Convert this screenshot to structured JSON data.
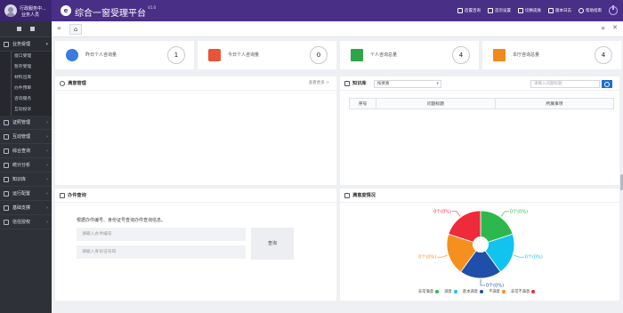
{
  "header": {
    "user_name": "行政服务中...",
    "user_role": "业务人员",
    "logo_glyph": "e",
    "title": "综合一窗受理平台",
    "version": "V1.0",
    "links": [
      "后置咨询",
      "首页设置",
      "切换皮肤",
      "版本日志",
      "帮助指南"
    ]
  },
  "sidebar": {
    "menu": [
      {
        "label": "业务受理",
        "open": true,
        "items": [
          "窗口受理",
          "暂存受理",
          "材料出库",
          "办件预审",
          "咨询服务",
          "互动投诉"
        ]
      },
      {
        "label": "证照管理",
        "open": false
      },
      {
        "label": "互动管理",
        "open": false
      },
      {
        "label": "综合查询",
        "open": false
      },
      {
        "label": "统计分析",
        "open": false
      },
      {
        "label": "知识库",
        "open": false
      },
      {
        "label": "运行配置",
        "open": false
      },
      {
        "label": "基础支撑",
        "open": false
      },
      {
        "label": "信任授权",
        "open": false
      }
    ]
  },
  "tabs": {
    "home_glyph": "⌂"
  },
  "stats": [
    {
      "label": "昨日个人咨询量",
      "value": "1",
      "color": "#3a7be0"
    },
    {
      "label": "今日个人咨询量",
      "value": "0",
      "color": "#e8543a"
    },
    {
      "label": "个人咨询总量",
      "value": "4",
      "color": "#2fa54a"
    },
    {
      "label": "本厅咨询总量",
      "value": "4",
      "color": "#f08a1c"
    }
  ],
  "satisfaction_panel": {
    "title": "满意管理",
    "more": "查看更多 >"
  },
  "knowledge_panel": {
    "title": "知识库",
    "select_value": "按要素",
    "search_placeholder": "请输入问题标题",
    "columns": [
      "序号",
      "问题标题",
      "所属事项"
    ]
  },
  "query_panel": {
    "title": "办件查询",
    "instruction": "根据办件编号、身份证号查询办件查询信息。",
    "case_placeholder": "请输入办件编号",
    "id_placeholder": "请输入身份证号码",
    "button_label": "查询"
  },
  "chart_panel": {
    "title": "满意度情况"
  },
  "chart_data": {
    "type": "pie",
    "title": "满意度情况",
    "series": [
      {
        "name": "非常满意",
        "value": 0,
        "label": "0个(0%)",
        "color": "#2db84d"
      },
      {
        "name": "满意",
        "value": 0,
        "label": "0个(0%)",
        "color": "#12c3f0"
      },
      {
        "name": "基本满意",
        "value": 0,
        "label": "0个(0%)",
        "color": "#1f4fa8"
      },
      {
        "name": "不满意",
        "value": 0,
        "label": "0个(0%)",
        "color": "#f5901e"
      },
      {
        "name": "非常不满意",
        "value": 0,
        "label": "0个(0%)",
        "color": "#ee2b3b"
      }
    ],
    "legend_position": "bottom"
  }
}
